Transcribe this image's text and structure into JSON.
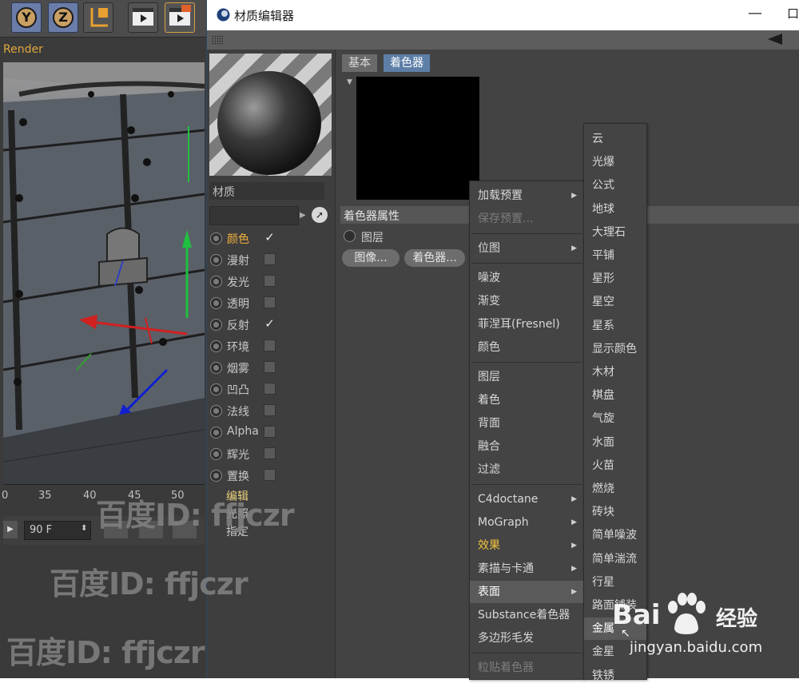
{
  "viewport": {
    "render_label": "Render",
    "axis_buttons": [
      "Y",
      "Z"
    ],
    "timeline_ticks": [
      "0",
      "35",
      "40",
      "45",
      "50"
    ],
    "frame_value": "90 F"
  },
  "editor": {
    "title": "材质编辑器",
    "window_controls": {
      "minimize": "—",
      "restore": "口"
    },
    "material_name": "材质",
    "channels": [
      {
        "label": "颜色",
        "checked": true,
        "active": true
      },
      {
        "label": "漫射",
        "checked": false
      },
      {
        "label": "发光",
        "checked": false
      },
      {
        "label": "透明",
        "checked": false
      },
      {
        "label": "反射",
        "checked": true
      },
      {
        "label": "环境",
        "checked": false
      },
      {
        "label": "烟雾",
        "checked": false
      },
      {
        "label": "凹凸",
        "checked": false
      },
      {
        "label": "法线",
        "checked": false
      },
      {
        "label": "Alpha",
        "checked": false
      },
      {
        "label": "辉光",
        "checked": false
      },
      {
        "label": "置换",
        "checked": false
      }
    ],
    "sub_items": [
      {
        "label": "编辑",
        "active": true
      },
      {
        "label": "光照"
      },
      {
        "label": "指定"
      }
    ],
    "tabs": [
      {
        "label": "基本",
        "selected": false
      },
      {
        "label": "着色器",
        "selected": true
      }
    ],
    "attributes_header": "着色器属性",
    "layer_label": "图层",
    "buttons": {
      "image": "图像...",
      "shader": "着色器..."
    }
  },
  "menu1": {
    "items": [
      {
        "label": "加载预置",
        "submenu": true
      },
      {
        "label": "保存预置...",
        "disabled": true
      },
      {
        "sep": true
      },
      {
        "label": "位图",
        "submenu": true
      },
      {
        "sep": true
      },
      {
        "label": "噪波"
      },
      {
        "label": "渐变"
      },
      {
        "label": "菲涅耳(Fresnel)"
      },
      {
        "label": "颜色"
      },
      {
        "sep": true
      },
      {
        "label": "图层"
      },
      {
        "label": "着色"
      },
      {
        "label": "背面"
      },
      {
        "label": "融合"
      },
      {
        "label": "过滤"
      },
      {
        "sep": true
      },
      {
        "label": "C4doctane",
        "submenu": true
      },
      {
        "label": "MoGraph",
        "submenu": true
      },
      {
        "label": "效果",
        "submenu": true,
        "highlight": true
      },
      {
        "label": "素描与卡通",
        "submenu": true
      },
      {
        "label": "表面",
        "submenu": true,
        "hover": true
      },
      {
        "label": "Substance着色器"
      },
      {
        "label": "多边形毛发"
      },
      {
        "sep": true
      },
      {
        "label": "粒贴着色器",
        "disabled": true
      }
    ]
  },
  "menu2": {
    "items": [
      "云",
      "光爆",
      "公式",
      "地球",
      "大理石",
      "平铺",
      "星形",
      "星空",
      "星系",
      "显示颜色",
      "木材",
      "棋盘",
      "气旋",
      "水面",
      "火苗",
      "燃烧",
      "砖块",
      "简单噪波",
      "简单湍流",
      "行星",
      "路面铺装",
      "金属",
      "金星",
      "铁锈"
    ],
    "hover_index": 21
  },
  "watermarks": [
    "百度ID: ffjczr",
    "百度ID: ffjczr",
    "百度ID: ffjczr"
  ],
  "baidu": {
    "logo_text": "Bai",
    "logo_cn": "经验",
    "url": "jingyan.baidu.com"
  }
}
